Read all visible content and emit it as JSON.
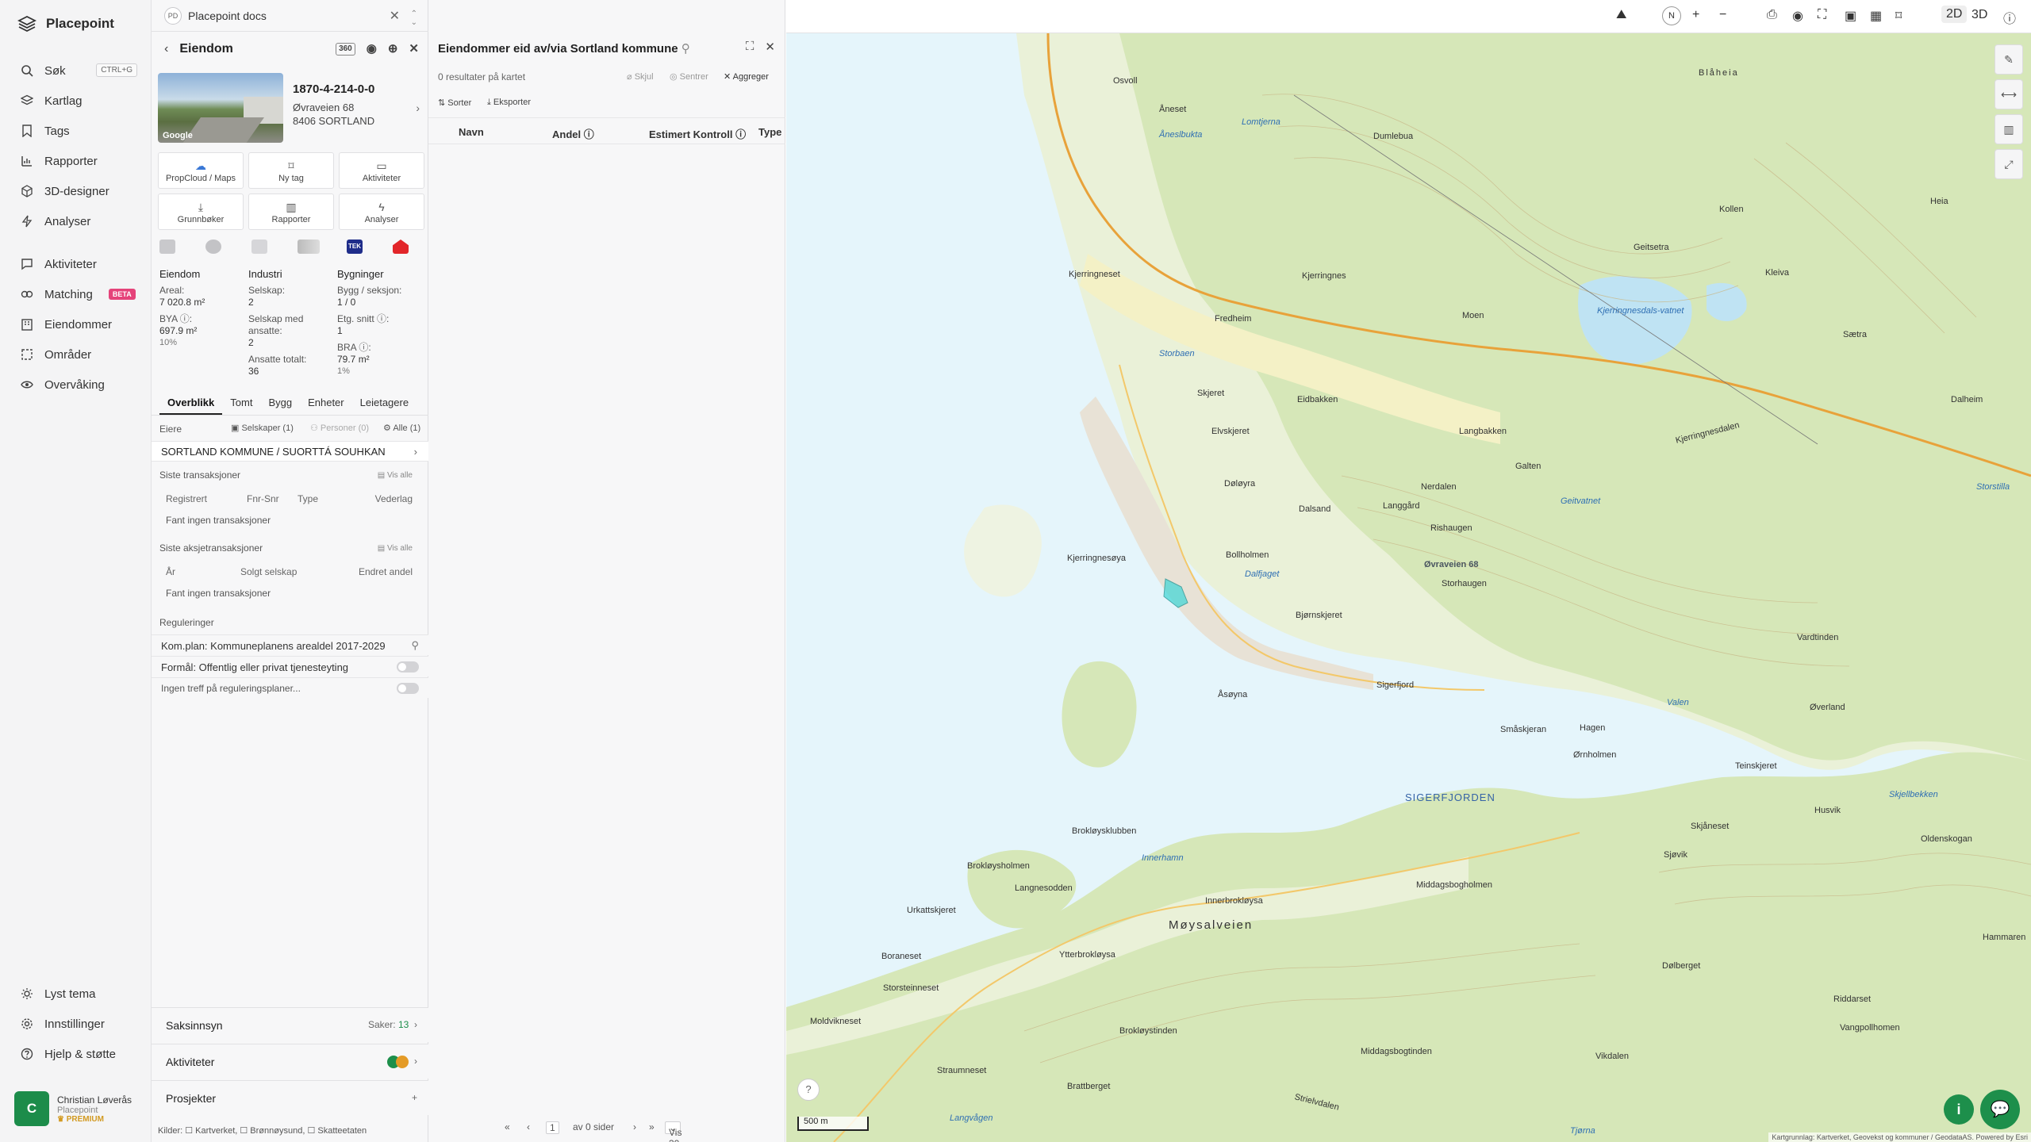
{
  "nav": {
    "brand": "Placepoint",
    "items": [
      {
        "label": "Søk",
        "shortcut": "CTRL+G",
        "icon": "search-icon"
      },
      {
        "label": "Kartlag",
        "icon": "layers-icon"
      },
      {
        "label": "Tags",
        "icon": "bookmark-icon"
      },
      {
        "label": "Rapporter",
        "icon": "chart-icon"
      },
      {
        "label": "3D-designer",
        "icon": "cube-icon"
      },
      {
        "label": "Analyser",
        "icon": "bolt-icon"
      },
      {
        "label": "Aktiviteter",
        "icon": "chat-icon"
      },
      {
        "label": "Matching",
        "badge": "BETA",
        "icon": "matching-icon"
      },
      {
        "label": "Eiendommer",
        "icon": "building-icon"
      },
      {
        "label": "Områder",
        "icon": "area-icon"
      },
      {
        "label": "Overvåking",
        "icon": "eye-icon"
      }
    ],
    "bottom": [
      {
        "label": "Lyst tema",
        "icon": "sun-icon"
      },
      {
        "label": "Innstillinger",
        "icon": "gear-icon"
      },
      {
        "label": "Hjelp & støtte",
        "icon": "help-icon"
      }
    ],
    "user": {
      "initial": "C",
      "name": "Christian Løverås",
      "org": "Placepoint",
      "plan": "PREMIUM"
    }
  },
  "doc": {
    "badge": "PD",
    "title": "Placepoint docs"
  },
  "property": {
    "header": "Eiendom",
    "image_caption": "Google",
    "id": "1870-4-214-0-0",
    "street": "Øvraveien 68",
    "postal": "8406 SORTLAND",
    "tiles": [
      {
        "label": "PropCloud / Maps"
      },
      {
        "label": "Ny tag"
      },
      {
        "label": "Aktiviteter"
      },
      {
        "label": "Grunnbøker"
      },
      {
        "label": "Rapporter"
      },
      {
        "label": "Analyser"
      }
    ],
    "tek_badge": "TEK",
    "stats": {
      "eiendom": {
        "title": "Eiendom",
        "areal_label": "Areal:",
        "areal": "7 020.8 m²",
        "bya_label": "BYA ⓘ:",
        "bya": "697.9 m²",
        "bya_pct": "10%"
      },
      "industri": {
        "title": "Industri",
        "selskap_label": "Selskap:",
        "selskap": "2",
        "ansatte_label": "Selskap med ansatte:",
        "ansatte": "2",
        "total_label": "Ansatte totalt:",
        "total": "36"
      },
      "bygninger": {
        "title": "Bygninger",
        "bygg_label": "Bygg / seksjon:",
        "bygg": "1 / 0",
        "etg_label": "Etg. snitt ⓘ:",
        "etg": "1",
        "bra_label": "BRA ⓘ:",
        "bra": "79.7 m²",
        "bra_pct": "1%"
      }
    },
    "tabs": [
      "Overblikk",
      "Tomt",
      "Bygg",
      "Enheter",
      "Leietagere"
    ],
    "owners": {
      "label": "Eiere",
      "companies": "Selskaper (1)",
      "persons": "Personer (0)",
      "all": "Alle (1)",
      "owner": "SORTLAND KOMMUNE / SUORTTÁ SOUHKAN"
    },
    "transactions": {
      "title": "Siste transaksjoner",
      "see_all": "Vis alle",
      "cols": [
        "Registrert",
        "Fnr-Snr",
        "Type",
        "Vederlag"
      ],
      "empty": "Fant ingen transaksjoner"
    },
    "share_transactions": {
      "title": "Siste aksjetransaksjoner",
      "see_all": "Vis alle",
      "cols": [
        "År",
        "Solgt selskap",
        "Endret andel"
      ],
      "empty": "Fant ingen transaksjoner"
    },
    "regulations": {
      "title": "Reguleringer",
      "plan": "Kom.plan: Kommuneplanens arealdel 2017-2029",
      "purpose": "Formål: Offentlig eller privat tjenesteyting",
      "none": "Ingen treff på reguleringsplaner..."
    },
    "saksinnsyn": {
      "label": "Saksinnsyn",
      "count_label": "Saker:",
      "count": "13"
    },
    "aktiviteter": {
      "label": "Aktiviteter"
    },
    "prosjekter": {
      "label": "Prosjekter"
    },
    "sources": "Kilder: ☐ Kartverket, ☐ Brønnøysund, ☐ Skatteetaten"
  },
  "list": {
    "title": "Eiendommer eid av/via Sortland kommune",
    "results": "0 resultater på kartet",
    "hide": "Skjul",
    "center": "Sentrer",
    "aggregate": "Aggreger",
    "sort": "Sorter",
    "export": "Eksporter",
    "cols": [
      "Navn",
      "Andel ⓘ",
      "Estimert Kontroll ⓘ",
      "Type"
    ],
    "pager": {
      "page": "1",
      "of": "av 0 sider",
      "per_page": "Vis 30"
    }
  },
  "map": {
    "mode_2d": "2D",
    "mode_3d": "3D",
    "north": "N",
    "scale": "500 m",
    "pin_label": "Øvraveien 68",
    "credit": "Kartgrunnlag: Kartverket, Geovekst og kommuner / GeodataAS. Powered by Esri",
    "place_labels": [
      "Osvoll",
      "Åneset",
      "Blåheia",
      "Kjerringneset",
      "Kjerringnes",
      "Fredheim",
      "Kollen",
      "Geitsetra",
      "Kleiva",
      "Moen",
      "Sætra",
      "Skjeret",
      "Eidbakken",
      "Elvskjeret",
      "Langbakken",
      "Kjerringnesdalen",
      "Galten",
      "Dalheim",
      "Døløyra",
      "Dalsand",
      "Nerdalen",
      "Langgård",
      "Rishaugen",
      "Kjerringnesøya",
      "Bollholmen",
      "Storhaugen",
      "Bjørnskjeret",
      "Vardtinden",
      "Sigerfjord",
      "Åsøyna",
      "Hagen",
      "Småskjeran",
      "Øverland",
      "Ørnholmen",
      "Teinskjeret",
      "Husvik",
      "Brokløysklubben",
      "Skjåneset",
      "Sjøvik",
      "Brokløysholmen",
      "Langnesodden",
      "Middagsbogholmen",
      "Innerbrokløysa",
      "Urkattskjeret",
      "Møysalveien",
      "Ytterbrokløysa",
      "Dølberget",
      "Boraneset",
      "Storsteinneset",
      "Brokløystinden",
      "Middagsbogtinden",
      "Moldvikneset",
      "Straumneset",
      "Brattberget",
      "Vikdalen",
      "Vangpollhomen",
      "Hammaren",
      "Riddarset",
      "Strielvdalen",
      "Oldenskogan",
      "Heia",
      "Dumlebua"
    ],
    "water_labels": [
      "Lomtjerna",
      "Åneslbukta",
      "Kjerringnesdals-vatnet",
      "Storbaen",
      "Geitvatnet",
      "Dalfjaget",
      "Valen",
      "Innerhamn",
      "Langvågen",
      "Tjørna",
      "Storstilla",
      "Skjellbekken"
    ],
    "fjord_label": "SIGERFJORDEN"
  }
}
